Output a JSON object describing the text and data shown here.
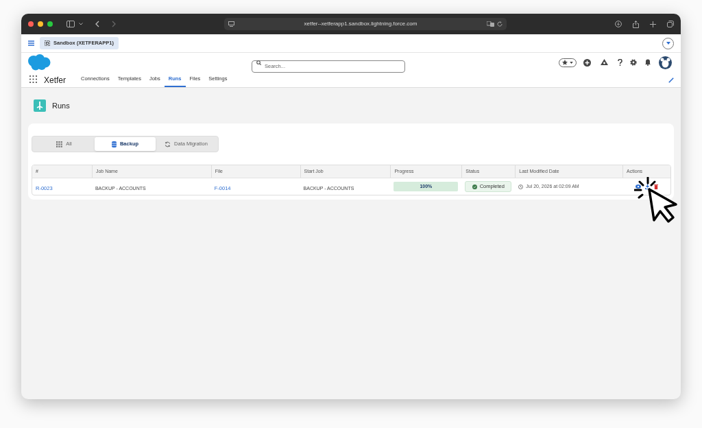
{
  "browser": {
    "url": "xetfer--xetferapp1.sandbox.lightning.force.com"
  },
  "app_tab": {
    "label": "Sandbox (XETFERAPP1)"
  },
  "header": {
    "search": {
      "placeholder": "Search..."
    }
  },
  "app_name": "Xetfer",
  "nav": [
    {
      "label": "Connections",
      "selected": false
    },
    {
      "label": "Templates",
      "selected": false
    },
    {
      "label": "Jobs",
      "selected": false
    },
    {
      "label": "Runs",
      "selected": true
    },
    {
      "label": "Files",
      "selected": false
    },
    {
      "label": "Settings",
      "selected": false
    }
  ],
  "page_title": "Runs",
  "filter_tabs": [
    {
      "label": "All",
      "kind": "grid",
      "selected": false
    },
    {
      "label": "Backup",
      "kind": "database",
      "selected": true
    },
    {
      "label": "Data Migration",
      "kind": "sync",
      "selected": false
    }
  ],
  "table": {
    "columns": [
      "#",
      "Job Name",
      "File",
      "Start Job",
      "Progress",
      "Status",
      "Last Modified Date",
      "Actions"
    ],
    "rows": [
      {
        "id": "R-0023",
        "job_name": "BACKUP - ACCOUNTS",
        "file": "F-0014",
        "start_job": "BACKUP - ACCOUNTS",
        "progress": {
          "level": 1,
          "label": "100%"
        },
        "status": "Completed",
        "modified": "Jul 20, 2026 at 02:09 AM"
      }
    ]
  }
}
